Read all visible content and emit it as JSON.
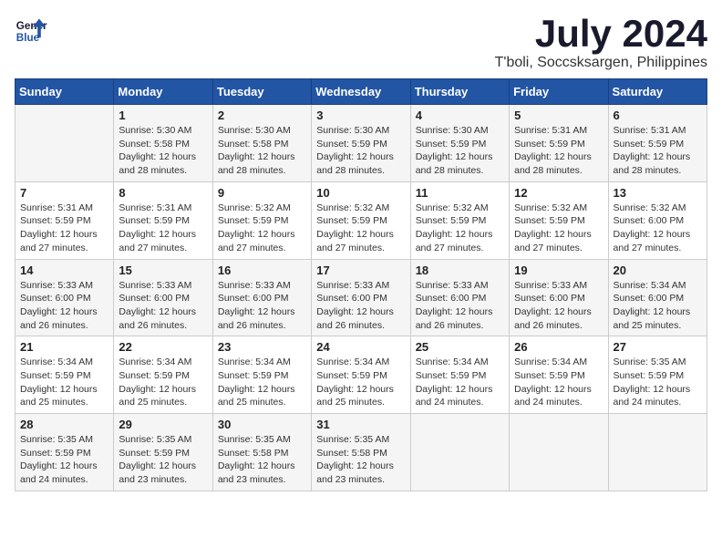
{
  "logo": {
    "line1": "General",
    "line2": "Blue"
  },
  "title": "July 2024",
  "subtitle": "T'boli, Soccsksargen, Philippines",
  "weekdays": [
    "Sunday",
    "Monday",
    "Tuesday",
    "Wednesday",
    "Thursday",
    "Friday",
    "Saturday"
  ],
  "weeks": [
    [
      {
        "day": "",
        "info": ""
      },
      {
        "day": "1",
        "info": "Sunrise: 5:30 AM\nSunset: 5:58 PM\nDaylight: 12 hours\nand 28 minutes."
      },
      {
        "day": "2",
        "info": "Sunrise: 5:30 AM\nSunset: 5:58 PM\nDaylight: 12 hours\nand 28 minutes."
      },
      {
        "day": "3",
        "info": "Sunrise: 5:30 AM\nSunset: 5:59 PM\nDaylight: 12 hours\nand 28 minutes."
      },
      {
        "day": "4",
        "info": "Sunrise: 5:30 AM\nSunset: 5:59 PM\nDaylight: 12 hours\nand 28 minutes."
      },
      {
        "day": "5",
        "info": "Sunrise: 5:31 AM\nSunset: 5:59 PM\nDaylight: 12 hours\nand 28 minutes."
      },
      {
        "day": "6",
        "info": "Sunrise: 5:31 AM\nSunset: 5:59 PM\nDaylight: 12 hours\nand 28 minutes."
      }
    ],
    [
      {
        "day": "7",
        "info": "Sunrise: 5:31 AM\nSunset: 5:59 PM\nDaylight: 12 hours\nand 27 minutes."
      },
      {
        "day": "8",
        "info": "Sunrise: 5:31 AM\nSunset: 5:59 PM\nDaylight: 12 hours\nand 27 minutes."
      },
      {
        "day": "9",
        "info": "Sunrise: 5:32 AM\nSunset: 5:59 PM\nDaylight: 12 hours\nand 27 minutes."
      },
      {
        "day": "10",
        "info": "Sunrise: 5:32 AM\nSunset: 5:59 PM\nDaylight: 12 hours\nand 27 minutes."
      },
      {
        "day": "11",
        "info": "Sunrise: 5:32 AM\nSunset: 5:59 PM\nDaylight: 12 hours\nand 27 minutes."
      },
      {
        "day": "12",
        "info": "Sunrise: 5:32 AM\nSunset: 5:59 PM\nDaylight: 12 hours\nand 27 minutes."
      },
      {
        "day": "13",
        "info": "Sunrise: 5:32 AM\nSunset: 6:00 PM\nDaylight: 12 hours\nand 27 minutes."
      }
    ],
    [
      {
        "day": "14",
        "info": "Sunrise: 5:33 AM\nSunset: 6:00 PM\nDaylight: 12 hours\nand 26 minutes."
      },
      {
        "day": "15",
        "info": "Sunrise: 5:33 AM\nSunset: 6:00 PM\nDaylight: 12 hours\nand 26 minutes."
      },
      {
        "day": "16",
        "info": "Sunrise: 5:33 AM\nSunset: 6:00 PM\nDaylight: 12 hours\nand 26 minutes."
      },
      {
        "day": "17",
        "info": "Sunrise: 5:33 AM\nSunset: 6:00 PM\nDaylight: 12 hours\nand 26 minutes."
      },
      {
        "day": "18",
        "info": "Sunrise: 5:33 AM\nSunset: 6:00 PM\nDaylight: 12 hours\nand 26 minutes."
      },
      {
        "day": "19",
        "info": "Sunrise: 5:33 AM\nSunset: 6:00 PM\nDaylight: 12 hours\nand 26 minutes."
      },
      {
        "day": "20",
        "info": "Sunrise: 5:34 AM\nSunset: 6:00 PM\nDaylight: 12 hours\nand 25 minutes."
      }
    ],
    [
      {
        "day": "21",
        "info": "Sunrise: 5:34 AM\nSunset: 5:59 PM\nDaylight: 12 hours\nand 25 minutes."
      },
      {
        "day": "22",
        "info": "Sunrise: 5:34 AM\nSunset: 5:59 PM\nDaylight: 12 hours\nand 25 minutes."
      },
      {
        "day": "23",
        "info": "Sunrise: 5:34 AM\nSunset: 5:59 PM\nDaylight: 12 hours\nand 25 minutes."
      },
      {
        "day": "24",
        "info": "Sunrise: 5:34 AM\nSunset: 5:59 PM\nDaylight: 12 hours\nand 25 minutes."
      },
      {
        "day": "25",
        "info": "Sunrise: 5:34 AM\nSunset: 5:59 PM\nDaylight: 12 hours\nand 24 minutes."
      },
      {
        "day": "26",
        "info": "Sunrise: 5:34 AM\nSunset: 5:59 PM\nDaylight: 12 hours\nand 24 minutes."
      },
      {
        "day": "27",
        "info": "Sunrise: 5:35 AM\nSunset: 5:59 PM\nDaylight: 12 hours\nand 24 minutes."
      }
    ],
    [
      {
        "day": "28",
        "info": "Sunrise: 5:35 AM\nSunset: 5:59 PM\nDaylight: 12 hours\nand 24 minutes."
      },
      {
        "day": "29",
        "info": "Sunrise: 5:35 AM\nSunset: 5:59 PM\nDaylight: 12 hours\nand 23 minutes."
      },
      {
        "day": "30",
        "info": "Sunrise: 5:35 AM\nSunset: 5:58 PM\nDaylight: 12 hours\nand 23 minutes."
      },
      {
        "day": "31",
        "info": "Sunrise: 5:35 AM\nSunset: 5:58 PM\nDaylight: 12 hours\nand 23 minutes."
      },
      {
        "day": "",
        "info": ""
      },
      {
        "day": "",
        "info": ""
      },
      {
        "day": "",
        "info": ""
      }
    ]
  ]
}
